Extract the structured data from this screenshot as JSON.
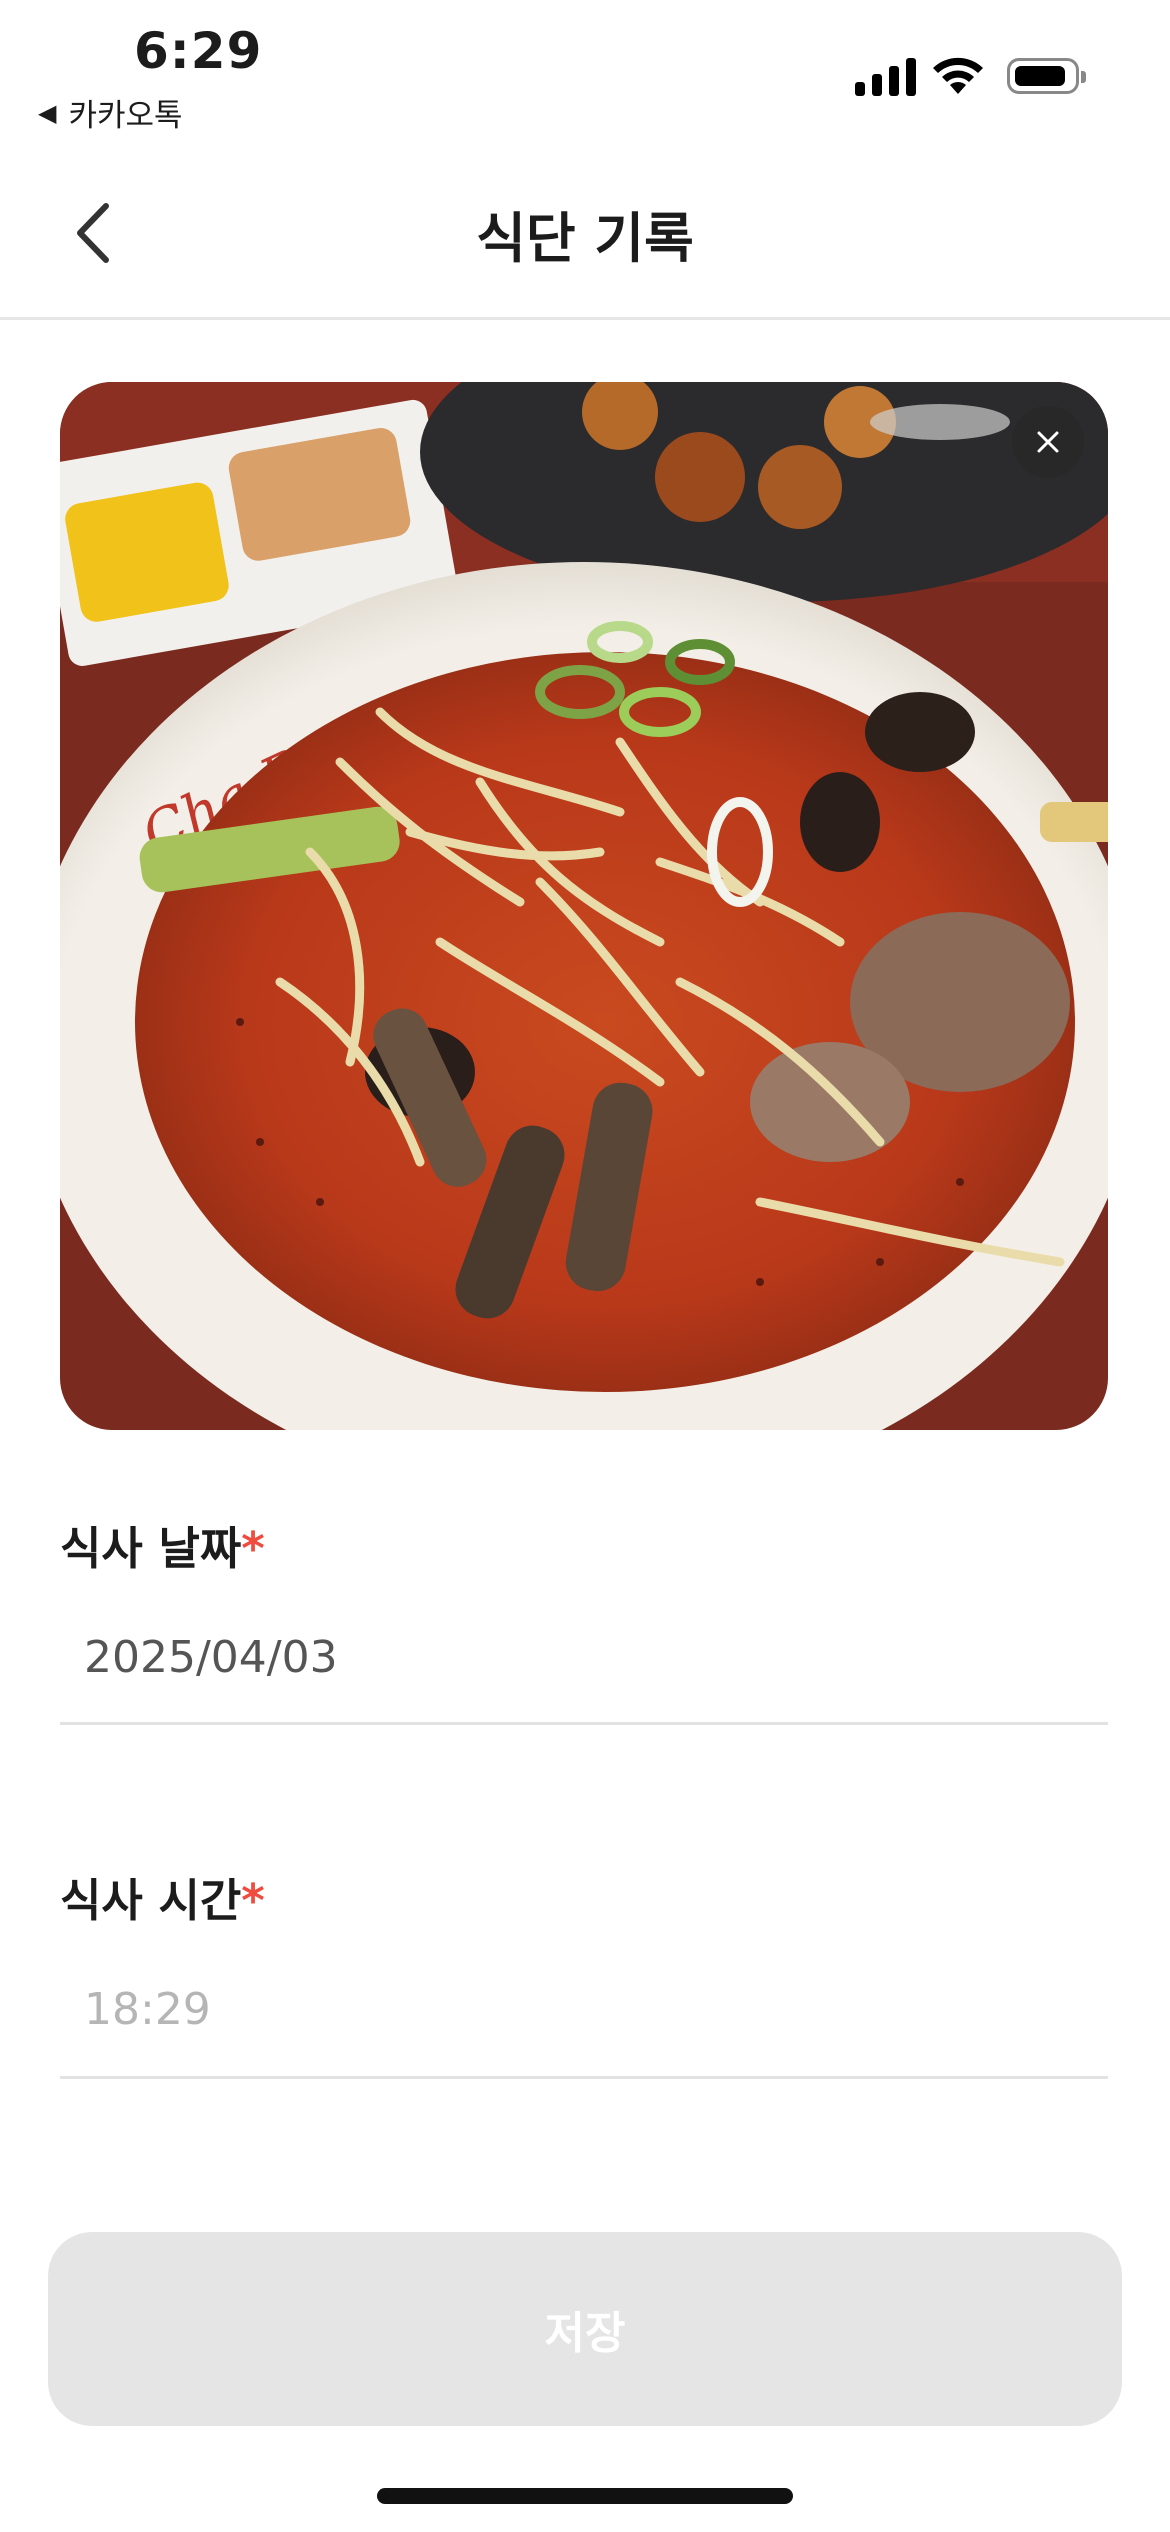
{
  "status_bar": {
    "time": "6:29",
    "back_app": "카카오톡",
    "back_arrow": "◀"
  },
  "nav": {
    "title": "식단 기록",
    "back_icon": "chevron-left-icon"
  },
  "photo": {
    "description_icon": "food-photo",
    "close_icon": "close-icon"
  },
  "form": {
    "date": {
      "label": "식사 날짜",
      "required_mark": "*",
      "value": "2025/04/03"
    },
    "time": {
      "label": "식사 시간",
      "required_mark": "*",
      "placeholder": "18:29"
    }
  },
  "save_button": {
    "label": "저장",
    "enabled": false
  },
  "colors": {
    "accent_required": "#ef4b3f",
    "disabled_button": "#e5e5e5",
    "placeholder": "#b5b5b5",
    "value_text": "#555555"
  }
}
